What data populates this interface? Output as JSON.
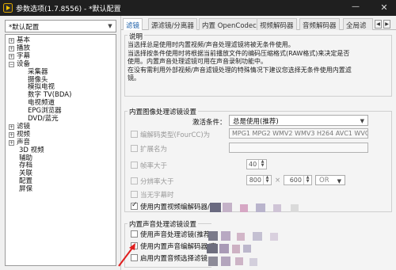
{
  "window": {
    "title": "参数选项(1.7.8556) - *默认配置"
  },
  "left": {
    "profile": "*默认配置",
    "tree": [
      {
        "label": "基本",
        "level": 0,
        "expander": "+"
      },
      {
        "label": "播放",
        "level": 0,
        "expander": "+"
      },
      {
        "label": "字幕",
        "level": 0,
        "expander": "+"
      },
      {
        "label": "设备",
        "level": 0,
        "expander": "−"
      },
      {
        "label": "采集器",
        "level": 1
      },
      {
        "label": "摄像头",
        "level": 1
      },
      {
        "label": "模拟电视",
        "level": 1
      },
      {
        "label": "数字 TV(BDA)",
        "level": 1
      },
      {
        "label": "电视频道",
        "level": 1
      },
      {
        "label": "EPG浏览器",
        "level": 1
      },
      {
        "label": "DVD/蓝光",
        "level": 1
      },
      {
        "label": "滤镜",
        "level": 0,
        "expander": "+"
      },
      {
        "label": "视频",
        "level": 0,
        "expander": "+"
      },
      {
        "label": "声音",
        "level": 0,
        "expander": "+"
      },
      {
        "label": "3D 视频",
        "level": 0
      },
      {
        "label": "辅助",
        "level": 0
      },
      {
        "label": "存档",
        "level": 0
      },
      {
        "label": "关联",
        "level": 0
      },
      {
        "label": "配置",
        "level": 0
      },
      {
        "label": "屏保",
        "level": 0
      }
    ]
  },
  "tabs": [
    "滤镜",
    "源滤镜/分离器",
    "内置 OpenCodec",
    "视频解码器",
    "音频解码器",
    "全局滤"
  ],
  "description": {
    "title": "说明",
    "lines": [
      "当选择总是使用时内置视频/声音处理滤镜将被无条件使用。",
      "当选择按条件使用时将根据当前播放文件的编码压缩格式(RAW格式)来决定是否",
      "使用。内置声音处理滤镜可用在声音录制功能中。",
      "在没有需利用外部视频/声音滤镜处理的特殊情况下建议您选择无条件使用内置滤",
      "镜。"
    ]
  },
  "image_filter": {
    "title": "内置图像处理滤镜设置",
    "activation_label": "激活条件：",
    "activation_value": "总是使用(推荐)",
    "codec_type_label": "编解码类型(FourCC)为",
    "codec_type_value": "MPG1 MPG2 WMV2 WMV3 H264 AVC1 WVC1",
    "ext_label": "扩展名为",
    "ext_value": "",
    "framerate_label": "帧率大于",
    "framerate_value": "40",
    "resolution_label": "分辨率大于",
    "res_w": "800",
    "res_x": "×",
    "res_h": "600",
    "res_mode": "OR",
    "no_subtitle_label": "当无字幕时",
    "use_video_decoder_label": "使用内置视频编解码器/图"
  },
  "audio_filter": {
    "title": "内置声音处理滤镜设置",
    "opt1": "使用声音处理滤镜(推荐",
    "opt2": "使用内置声音编解码器/声",
    "opt3": "启用内置音频选择滤镜"
  },
  "colors": {
    "accent": "#1a5ea8",
    "titlebar": "#1f1f1f",
    "annotation": "#e02020"
  },
  "icons": [
    "app-logo-icon",
    "minimize-icon",
    "close-icon",
    "dropdown-arrow-icon",
    "tree-expand-icon",
    "tree-collapse-icon",
    "scroll-left-icon",
    "scroll-right-icon",
    "spin-up-icon",
    "spin-down-icon",
    "annotation-arrow"
  ]
}
